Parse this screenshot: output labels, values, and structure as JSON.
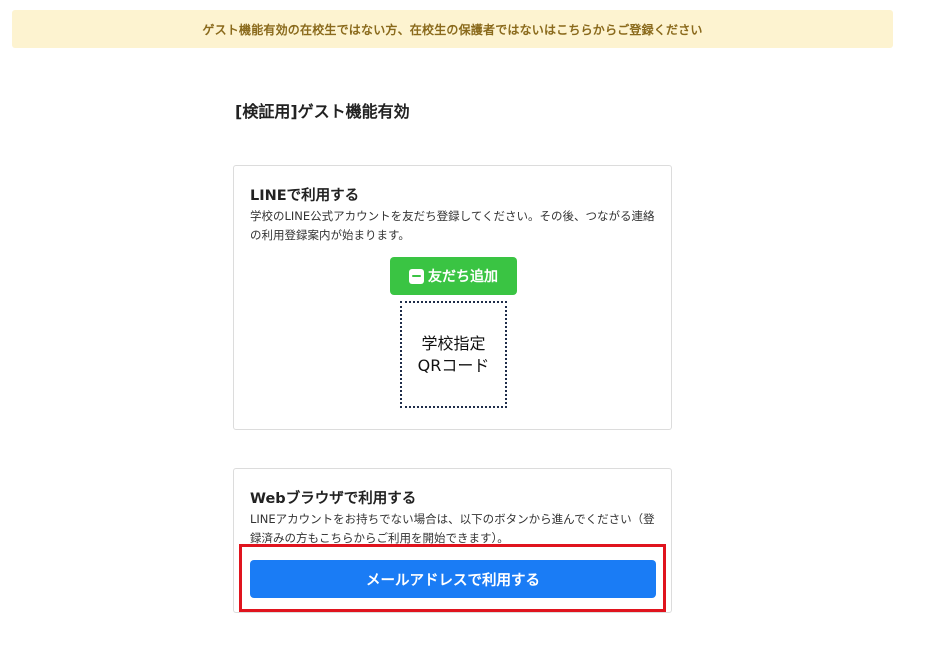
{
  "banner": {
    "text": "ゲスト機能有効の在校生ではない方、在校生の保護者ではないはこちらからご登録ください"
  },
  "page": {
    "title": "[検証用]ゲスト機能有効"
  },
  "line_card": {
    "heading": "LINEで利用する",
    "description": "学校のLINE公式アカウントを友だち登録してください。その後、つながる連絡の利用登録案内が始まります。",
    "add_friend_label": "友だち追加",
    "qr_placeholder": "学校指定\nQRコード"
  },
  "web_card": {
    "heading": "Webブラウザで利用する",
    "description": "LINEアカウントをお持ちでない場合は、以下のボタンから進んでください（登録済みの方もこちらからご利用を開始できます）。",
    "email_button_label": "メールアドレスで利用する"
  },
  "colors": {
    "banner_bg": "#fdf3d0",
    "line_green": "#3ac443",
    "primary_blue": "#1a7cf5",
    "highlight_red": "#e0141e"
  },
  "icons": {
    "line_logo": "line-icon"
  }
}
